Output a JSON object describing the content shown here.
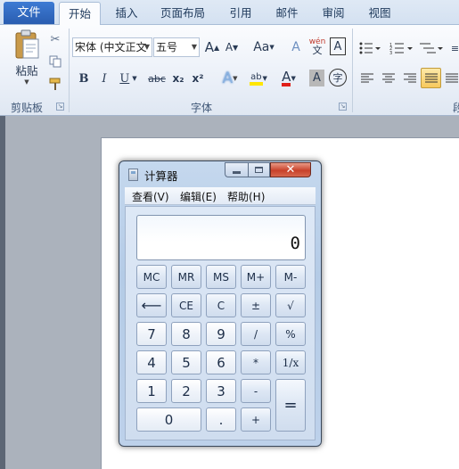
{
  "ribbon": {
    "tabs": [
      {
        "label": "文件"
      },
      {
        "label": "开始"
      },
      {
        "label": "插入"
      },
      {
        "label": "页面布局"
      },
      {
        "label": "引用"
      },
      {
        "label": "邮件"
      },
      {
        "label": "审阅"
      },
      {
        "label": "视图"
      }
    ],
    "clipboard": {
      "paste_label": "粘贴",
      "group_label": "剪贴板"
    },
    "font": {
      "font_name": "宋体 (中文正文",
      "font_size": "五号",
      "grow_label": "A",
      "shrink_label": "A",
      "case_label": "Aa",
      "clear_label": "A",
      "phonetic_label": "wén",
      "border_char_label": "A",
      "bold_label": "B",
      "italic_label": "I",
      "underline_label": "U",
      "strike_label": "abc",
      "subscript_label": "x₂",
      "superscript_label": "x²",
      "text_effect_label": "A",
      "highlight_label": "ab",
      "font_color_label": "A",
      "char_shading_label": "A",
      "enclose_char_label": "字",
      "group_label": "字体"
    },
    "paragraph": {
      "group_label_partial": "段"
    }
  },
  "calculator": {
    "title": "计算器",
    "menus": [
      {
        "label": "查看(V)"
      },
      {
        "label": "编辑(E)"
      },
      {
        "label": "帮助(H)"
      }
    ],
    "display_value": "0",
    "keys": {
      "mc": "MC",
      "mr": "MR",
      "ms": "MS",
      "mplus": "M+",
      "mminus": "M-",
      "back": "⟵",
      "ce": "CE",
      "c": "C",
      "negate": "±",
      "sqrt": "√",
      "k7": "7",
      "k8": "8",
      "k9": "9",
      "div": "/",
      "pct": "%",
      "k4": "4",
      "k5": "5",
      "k6": "6",
      "mul": "*",
      "recip": "1/x",
      "k1": "1",
      "k2": "2",
      "k3": "3",
      "sub": "-",
      "equals": "=",
      "k0": "0",
      "dot": ".",
      "add": "+"
    }
  },
  "colors": {
    "file_tab": "#2a5db0",
    "ribbon_bg": "#e8eef7",
    "calc_frame": "#b4cbe6",
    "close_button": "#c8412a",
    "document_bg": "#abb2bc"
  }
}
